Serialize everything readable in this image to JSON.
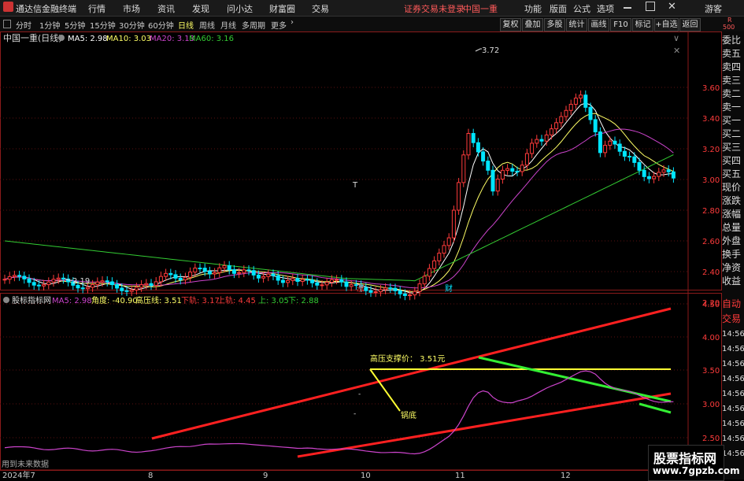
{
  "menu": {
    "app_name": "通达信金融终端",
    "items": [
      "行情",
      "市场",
      "资讯",
      "发现",
      "问小达",
      "财富圈",
      "交易"
    ],
    "status": "证券交易未登录",
    "stock_name": "中国一重",
    "right_items": [
      "功能",
      "版面",
      "公式",
      "选项"
    ],
    "guest": "游客"
  },
  "periods": {
    "items": [
      "分时",
      "1分钟",
      "5分钟",
      "15分钟",
      "30分钟",
      "60分钟",
      "日线",
      "周线",
      "月线",
      "多周期",
      "更多"
    ],
    "active": "日线",
    "right_buttons": [
      "复权",
      "叠加",
      "多股",
      "统计",
      "画线",
      "F10",
      "标记",
      "+自选",
      "返回"
    ],
    "rbadge": "R",
    "rbadge_num": "500"
  },
  "main_chart": {
    "title": "中国一重(日线)",
    "ma5": "MA5: 2.98",
    "ma10": "MA10: 3.03",
    "ma20": "MA20: 3.13",
    "ma60": "MA60: 3.16",
    "yticks": [
      "3.60",
      "3.40",
      "3.20",
      "3.00",
      "2.80",
      "2.60",
      "2.40",
      "2.20"
    ],
    "high_label": "3.72",
    "low_label": "2.19",
    "t_mark": "T",
    "zhang_mark": "涨",
    "cai_mark": "财"
  },
  "indicator": {
    "title": "股标指标网",
    "ma5": "MA5: 2.98",
    "angle": "角度: -40.90",
    "gaoya": "高压线: 3.51",
    "xiagui": "下轨: 3.17",
    "shanggui": "上轨: 4.45",
    "shang": "上: 3.05",
    "xia": "下: 2.88",
    "yticks": [
      "4.50",
      "4.00",
      "3.50",
      "3.00",
      "2.50"
    ],
    "support_label": "高压支撑价： 3.51元",
    "guodi_label": "锅底",
    "future_label": "用到未来数据"
  },
  "xaxis": {
    "labels": [
      "2024年7",
      "8",
      "9",
      "10",
      "11",
      "12"
    ]
  },
  "right_panel": {
    "items": [
      "委比",
      "卖五",
      "卖四",
      "卖三",
      "卖二",
      "卖一",
      "买一",
      "买二",
      "买三",
      "买四",
      "买五",
      "现价",
      "涨跌",
      "涨幅",
      "总量",
      "外盘",
      "换手",
      "净资",
      "收益"
    ],
    "items2": [
      "自动",
      "交易",
      "14:56",
      "14:56",
      "14:56",
      "14:56",
      "14:56",
      "14:56",
      "14:56",
      "14:56",
      "14:56"
    ]
  },
  "watermark": {
    "line1": "股票指标网",
    "line2": "www.7gpzb.com"
  },
  "colors": {
    "up": "#ff3b3b",
    "down": "#00e5ff",
    "ma5": "#ffffff",
    "ma10": "#ffff66",
    "ma20": "#cc44cc",
    "ma60": "#33cc33"
  }
}
